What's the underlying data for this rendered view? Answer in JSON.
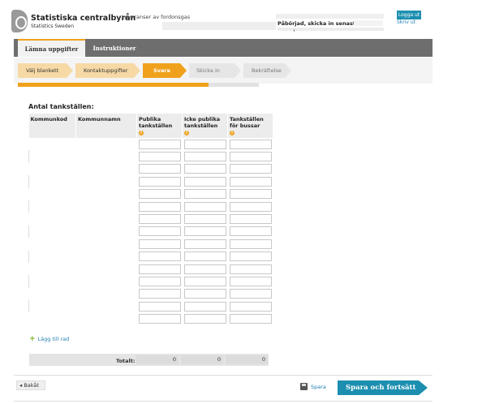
{
  "header": {
    "org_name": "Statistiska centralbyrån",
    "org_subtitle": "Statistics Sweden",
    "survey_title": "Leveranser av fordonsgas",
    "started_label": "Påbörjad, skicka in senast :",
    "login_label": "Logga ut",
    "logout_label": "Skriv ut"
  },
  "tabs": [
    {
      "label": "Lämna uppgifter",
      "active": true
    },
    {
      "label": "Instruktioner",
      "active": false
    }
  ],
  "steps": [
    {
      "label": "Välj blankett",
      "state": "done"
    },
    {
      "label": "Kontaktuppgifter",
      "state": "done"
    },
    {
      "label": "Svara",
      "state": "active"
    },
    {
      "label": "Skicka in",
      "state": "todo"
    },
    {
      "label": "Bekräftelse",
      "state": "todo"
    }
  ],
  "progress": 0.79,
  "section": {
    "title": "Antal tankställen:",
    "columns": [
      "Kommunkod",
      "Kommunnamn",
      "Publika tankställen",
      "Icke publika tankställen",
      "Tankställen för bussar"
    ],
    "info_icon": "info-icon"
  },
  "add_row_label": "Lägg till rad",
  "totals": {
    "label": "Totalt:",
    "values": [
      "0",
      "0",
      "0"
    ]
  },
  "footer": {
    "back_label": "Bakåt",
    "save_label": "Spara",
    "save_continue_label": "Spara och fortsätt"
  },
  "colors": {
    "accent": "#f0a11b",
    "primary_button": "#1c8fb0",
    "tab_bar": "#6e6e6e"
  }
}
